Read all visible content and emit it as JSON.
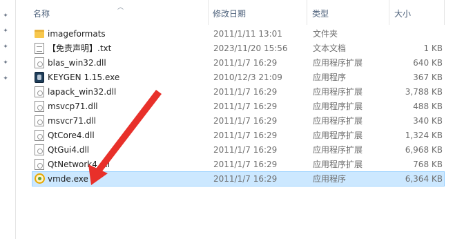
{
  "columns": {
    "name": "名称",
    "modified": "修改日期",
    "type": "类型",
    "size": "大小"
  },
  "files": [
    {
      "name": "imageformats",
      "date": "2011/1/11 13:01",
      "type": "文件夹",
      "size": "",
      "icon": "folder-icon"
    },
    {
      "name": "【免责声明】.txt",
      "date": "2023/11/20 15:56",
      "type": "文本文档",
      "size": "1 KB",
      "icon": "text-file-icon"
    },
    {
      "name": "blas_win32.dll",
      "date": "2011/1/7 16:29",
      "type": "应用程序扩展",
      "size": "640 KB",
      "icon": "dll-file-icon"
    },
    {
      "name": "KEYGEN 1.15.exe",
      "date": "2010/12/3 21:09",
      "type": "应用程序",
      "size": "367 KB",
      "icon": "keygen-app-icon"
    },
    {
      "name": "lapack_win32.dll",
      "date": "2011/1/7 16:29",
      "type": "应用程序扩展",
      "size": "3,788 KB",
      "icon": "dll-file-icon"
    },
    {
      "name": "msvcp71.dll",
      "date": "2011/1/7 16:29",
      "type": "应用程序扩展",
      "size": "488 KB",
      "icon": "dll-file-icon"
    },
    {
      "name": "msvcr71.dll",
      "date": "2011/1/7 16:29",
      "type": "应用程序扩展",
      "size": "340 KB",
      "icon": "dll-file-icon"
    },
    {
      "name": "QtCore4.dll",
      "date": "2011/1/7 16:29",
      "type": "应用程序扩展",
      "size": "1,324 KB",
      "icon": "dll-file-icon"
    },
    {
      "name": "QtGui4.dll",
      "date": "2011/1/7 16:29",
      "type": "应用程序扩展",
      "size": "6,968 KB",
      "icon": "dll-file-icon"
    },
    {
      "name": "QtNetwork4.dll",
      "date": "2011/1/7 16:29",
      "type": "应用程序扩展",
      "size": "768 KB",
      "icon": "dll-file-icon"
    },
    {
      "name": "vmde.exe",
      "date": "2011/1/7 16:29",
      "type": "应用程序",
      "size": "6,364 KB",
      "icon": "vmde-app-icon",
      "selected": true
    }
  ],
  "colors": {
    "selection_bg": "#cce8ff",
    "selection_border": "#99d1ff",
    "header_text": "#4c607a",
    "annotation_arrow": "#e8302a"
  }
}
